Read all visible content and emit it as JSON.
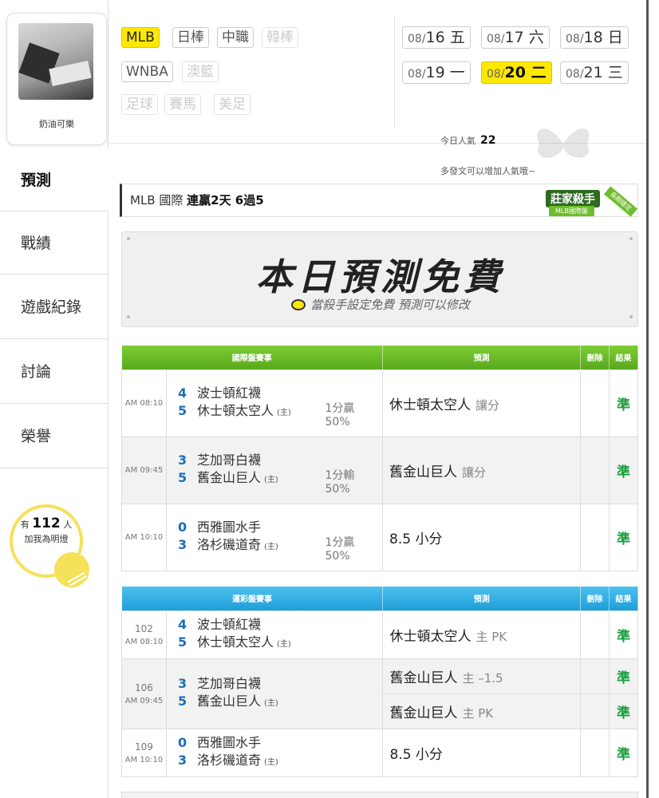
{
  "sidebar": {
    "username": "奶油可樂",
    "nav": [
      "預測",
      "戰績",
      "遊戲紀錄",
      "討論",
      "榮譽"
    ],
    "fans": {
      "prefix": "有",
      "count": "112",
      "suffix": "人",
      "line2": "加我為明燈"
    }
  },
  "filters": {
    "leagues": [
      {
        "label": "MLB",
        "state": "selected"
      },
      {
        "label": "日棒",
        "state": "normal"
      },
      {
        "label": "中職",
        "state": "normal"
      },
      {
        "label": "韓棒",
        "state": "disabled"
      },
      {
        "label": "WNBA",
        "state": "normal"
      },
      {
        "label": "澳籃",
        "state": "disabled"
      },
      {
        "label": "足球",
        "state": "disabled"
      },
      {
        "label": "賽馬",
        "state": "disabled"
      },
      {
        "label": "美足",
        "state": "disabled"
      }
    ],
    "dates": [
      {
        "md": "08/",
        "d": "16 五"
      },
      {
        "md": "08/",
        "d": "17 六"
      },
      {
        "md": "08/",
        "d": "18 日"
      },
      {
        "md": "08/",
        "d": "19 一"
      },
      {
        "md": "08/",
        "d": "20 二",
        "selected": true
      },
      {
        "md": "08/",
        "d": "21 三"
      }
    ],
    "popularity_label": "今日人氣",
    "popularity_value": "22",
    "popularity_hint": "多發文可以增加人氣哦~"
  },
  "title": {
    "league": "MLB 國際",
    "streak": "連贏2天 6過5"
  },
  "badge": {
    "main": "莊家殺手",
    "sub": "MLB國際盤",
    "ribbon": "長期穩定"
  },
  "banner": {
    "heading": "本日預測免費",
    "sub": "當殺手設定免費 預測可以修改"
  },
  "intl_table": {
    "headers": [
      "國際盤賽事",
      "預測",
      "刪除",
      "結果"
    ],
    "rows": [
      {
        "time": "AM 08:10",
        "away_score": "4",
        "away": "波士頓紅襪",
        "home_score": "5",
        "home": "休士頓太空人",
        "home_tag": "(主)",
        "line": "1分贏",
        "pct": "50%",
        "pick": "休士頓太空人",
        "pick_type": "讓分",
        "result": "準"
      },
      {
        "time": "AM 09:45",
        "away_score": "3",
        "away": "芝加哥白襪",
        "home_score": "5",
        "home": "舊金山巨人",
        "home_tag": "(主)",
        "line": "1分輸",
        "pct": "50%",
        "pick": "舊金山巨人",
        "pick_type": "讓分",
        "result": "準"
      },
      {
        "time": "AM 10:10",
        "away_score": "0",
        "away": "西雅圖水手",
        "home_score": "3",
        "home": "洛杉磯道奇",
        "home_tag": "(主)",
        "line": "1分贏",
        "pct": "50%",
        "pick": "8.5 小分",
        "pick_type": "",
        "result": "準"
      }
    ]
  },
  "lottery_table": {
    "headers": [
      "運彩盤賽事",
      "預測",
      "刪除",
      "結果"
    ],
    "rows": [
      {
        "code": "102",
        "time": "AM 08:10",
        "away_score": "4",
        "away": "波士頓紅襪",
        "home_score": "5",
        "home": "休士頓太空人",
        "home_tag": "(主)",
        "pick": "休士頓太空人",
        "pick_type": "主 PK",
        "result": "準"
      },
      {
        "code": "106",
        "time": "AM 09:45",
        "away_score": "3",
        "away": "芝加哥白襪",
        "home_score": "5",
        "home": "舊金山巨人",
        "home_tag": "(主)",
        "pick": "舊金山巨人",
        "pick_type": "主 –1.5",
        "result": "準",
        "pick2": "舊金山巨人",
        "pick2_type": "主 PK",
        "result2": "準"
      },
      {
        "code": "109",
        "time": "AM 10:10",
        "away_score": "0",
        "away": "西雅圖水手",
        "home_score": "3",
        "home": "洛杉磯道奇",
        "home_tag": "(主)",
        "pick": "8.5 小分",
        "pick_type": "",
        "result": "準"
      }
    ]
  },
  "colors": {
    "accent_yellow": "#ffe800",
    "green_header": "#6fbd2c",
    "blue_header": "#1e9fd9",
    "win_green": "#1b9e3f"
  }
}
